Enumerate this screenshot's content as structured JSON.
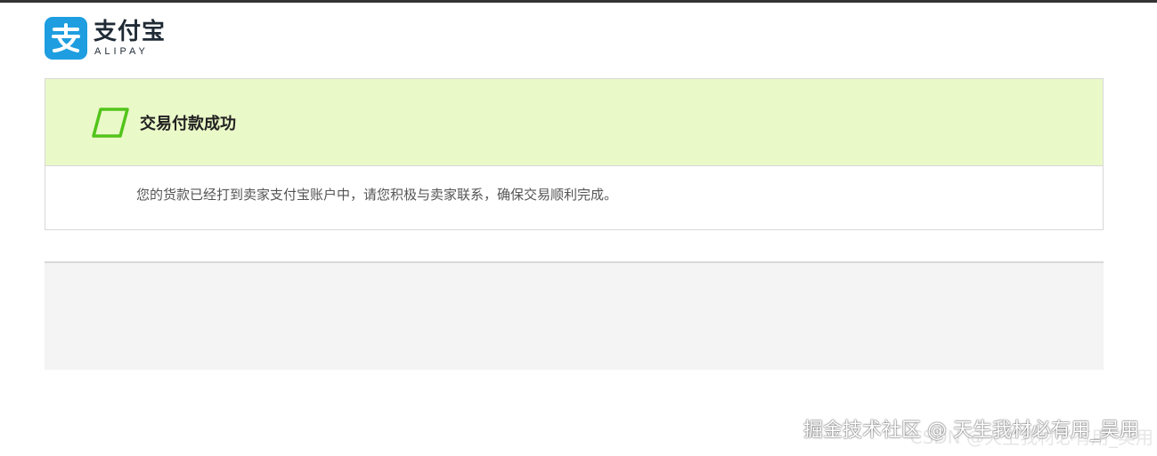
{
  "logo": {
    "chinese": "支付宝",
    "english": "ALIPAY",
    "brand_color": "#1e9ee0",
    "icon": "alipay-logo-icon"
  },
  "result": {
    "title": "交易付款成功",
    "message": "您的货款已经打到卖家支付宝账户中，请您积极与卖家联系，确保交易顺利完成。",
    "icon": "success-check-icon",
    "header_color": "#eaf9c8",
    "icon_color": "#52c41a"
  },
  "watermark": {
    "text": "掘金技术社区 @ 天生我材必有用_吴用",
    "secondary": "CSDN @天生我材必有用_吴用"
  }
}
